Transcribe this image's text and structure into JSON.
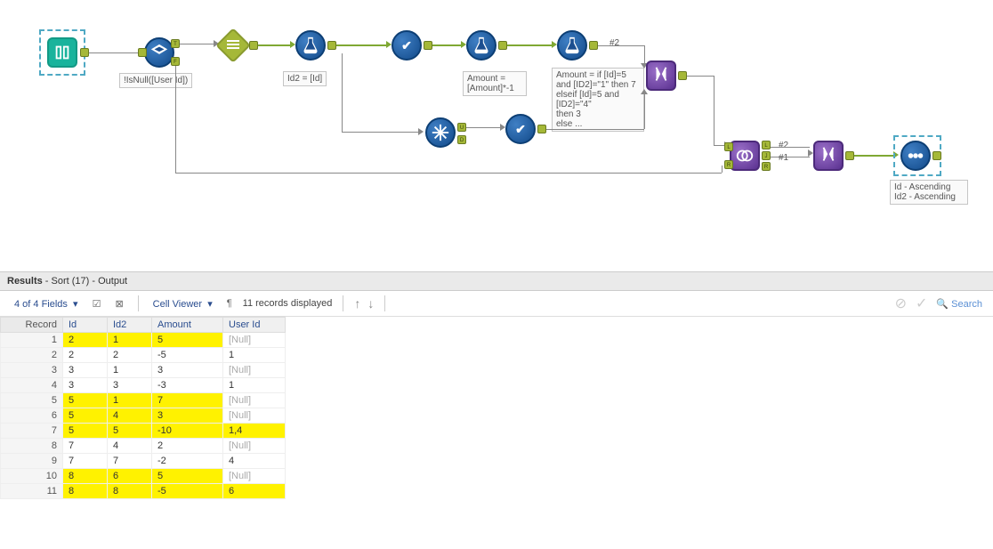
{
  "canvas": {
    "filter_label": "!IsNull([User Id])",
    "formula1_label": "Id2 = [Id]",
    "formula2_label": "Amount = [Amount]*-1",
    "formula3_label": "Amount = if [Id]=5 and [ID2]=\"1\" then 7\nelseif [Id]=5 and [ID2]=\"4\"\nthen 3\nelse ...",
    "sort_label": "Id - Ascending\nId2 - Ascending",
    "union_badge": "#2",
    "join_badge1": "#2",
    "join_badge2": "#1"
  },
  "results": {
    "header_bold": "Results",
    "header_rest": " - Sort (17) - Output",
    "field_count": "4 of 4 Fields",
    "cell_viewer": "Cell Viewer",
    "records_text": "11 records displayed",
    "search_label": "Search",
    "col_record": "Record",
    "col_id": "Id",
    "col_id2": "Id2",
    "col_amount": "Amount",
    "col_userid": "User Id",
    "rows": [
      {
        "r": "1",
        "id": "2",
        "id2": "1",
        "amt": "5",
        "uid": "[Null]",
        "hl": true,
        "uidnull": true
      },
      {
        "r": "2",
        "id": "2",
        "id2": "2",
        "amt": "-5",
        "uid": "1",
        "hl": false
      },
      {
        "r": "3",
        "id": "3",
        "id2": "1",
        "amt": "3",
        "uid": "[Null]",
        "hl": false,
        "uidnull": true
      },
      {
        "r": "4",
        "id": "3",
        "id2": "3",
        "amt": "-3",
        "uid": "1",
        "hl": false
      },
      {
        "r": "5",
        "id": "5",
        "id2": "1",
        "amt": "7",
        "uid": "[Null]",
        "hl": true,
        "uidnull": true
      },
      {
        "r": "6",
        "id": "5",
        "id2": "4",
        "amt": "3",
        "uid": "[Null]",
        "hl": true,
        "uidnull": true
      },
      {
        "r": "7",
        "id": "5",
        "id2": "5",
        "amt": "-10",
        "uid": "1,4",
        "hl": true
      },
      {
        "r": "8",
        "id": "7",
        "id2": "4",
        "amt": "2",
        "uid": "[Null]",
        "hl": false,
        "uidnull": true
      },
      {
        "r": "9",
        "id": "7",
        "id2": "7",
        "amt": "-2",
        "uid": "4",
        "hl": false
      },
      {
        "r": "10",
        "id": "8",
        "id2": "6",
        "amt": "5",
        "uid": "[Null]",
        "hl": true,
        "uidnull": true
      },
      {
        "r": "11",
        "id": "8",
        "id2": "8",
        "amt": "-5",
        "uid": "6",
        "hl": true
      }
    ]
  }
}
